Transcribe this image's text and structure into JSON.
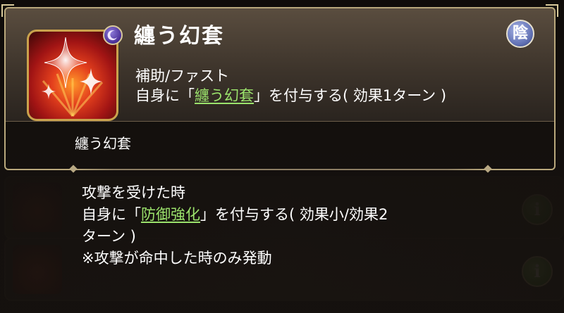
{
  "skill": {
    "name": "纏う幻套",
    "element": "陰",
    "type": "補助/ファスト",
    "desc_prefix": "自身に「",
    "desc_link": "纏う幻套",
    "desc_suffix": "」を付与する( 効果1ターン )"
  },
  "passive": {
    "name": "纏う幻套",
    "line1": "攻撃を受けた時",
    "line2_prefix": "自身に「",
    "line2_link": "防御強化",
    "line2_suffix": "」を付与する( 効果小/効果2",
    "line3": "ターン )",
    "line4": "※攻撃が命中した時のみ発動"
  },
  "colors": {
    "accent_green": "#9be36c",
    "frame_gold": "#b9a87c",
    "element_blue": "#5f6fb3"
  },
  "icons": {
    "skill_icon": "red-sparkles-icon",
    "badge": "crescent-moon-icon",
    "info": "info-icon"
  }
}
